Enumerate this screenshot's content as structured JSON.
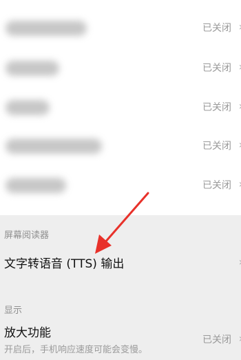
{
  "blurred_settings": [
    {
      "status": "已关闭",
      "chevron": "chevron-right-icon"
    },
    {
      "status": "已关闭",
      "chevron": "chevron-right-icon"
    },
    {
      "status": "已关闭",
      "chevron": "chevron-right-icon"
    },
    {
      "status": "已关闭",
      "chevron": "chevron-right-icon"
    },
    {
      "status": "已关闭",
      "chevron": "chevron-right-icon"
    }
  ],
  "screen_reader_section": {
    "header": "屏幕阅读器",
    "tts": {
      "label": "文字转语音 (TTS) 输出",
      "chevron": "chevron-right-icon"
    }
  },
  "display_section": {
    "header": "显示",
    "magnification": {
      "label": "放大功能",
      "subtitle": "开启后，手机响应速度可能会变慢。",
      "status": "已关闭"
    }
  },
  "colors": {
    "annotation_arrow": "#e8312a",
    "status_text": "#9a9a9a",
    "background": "#eeeeee"
  }
}
